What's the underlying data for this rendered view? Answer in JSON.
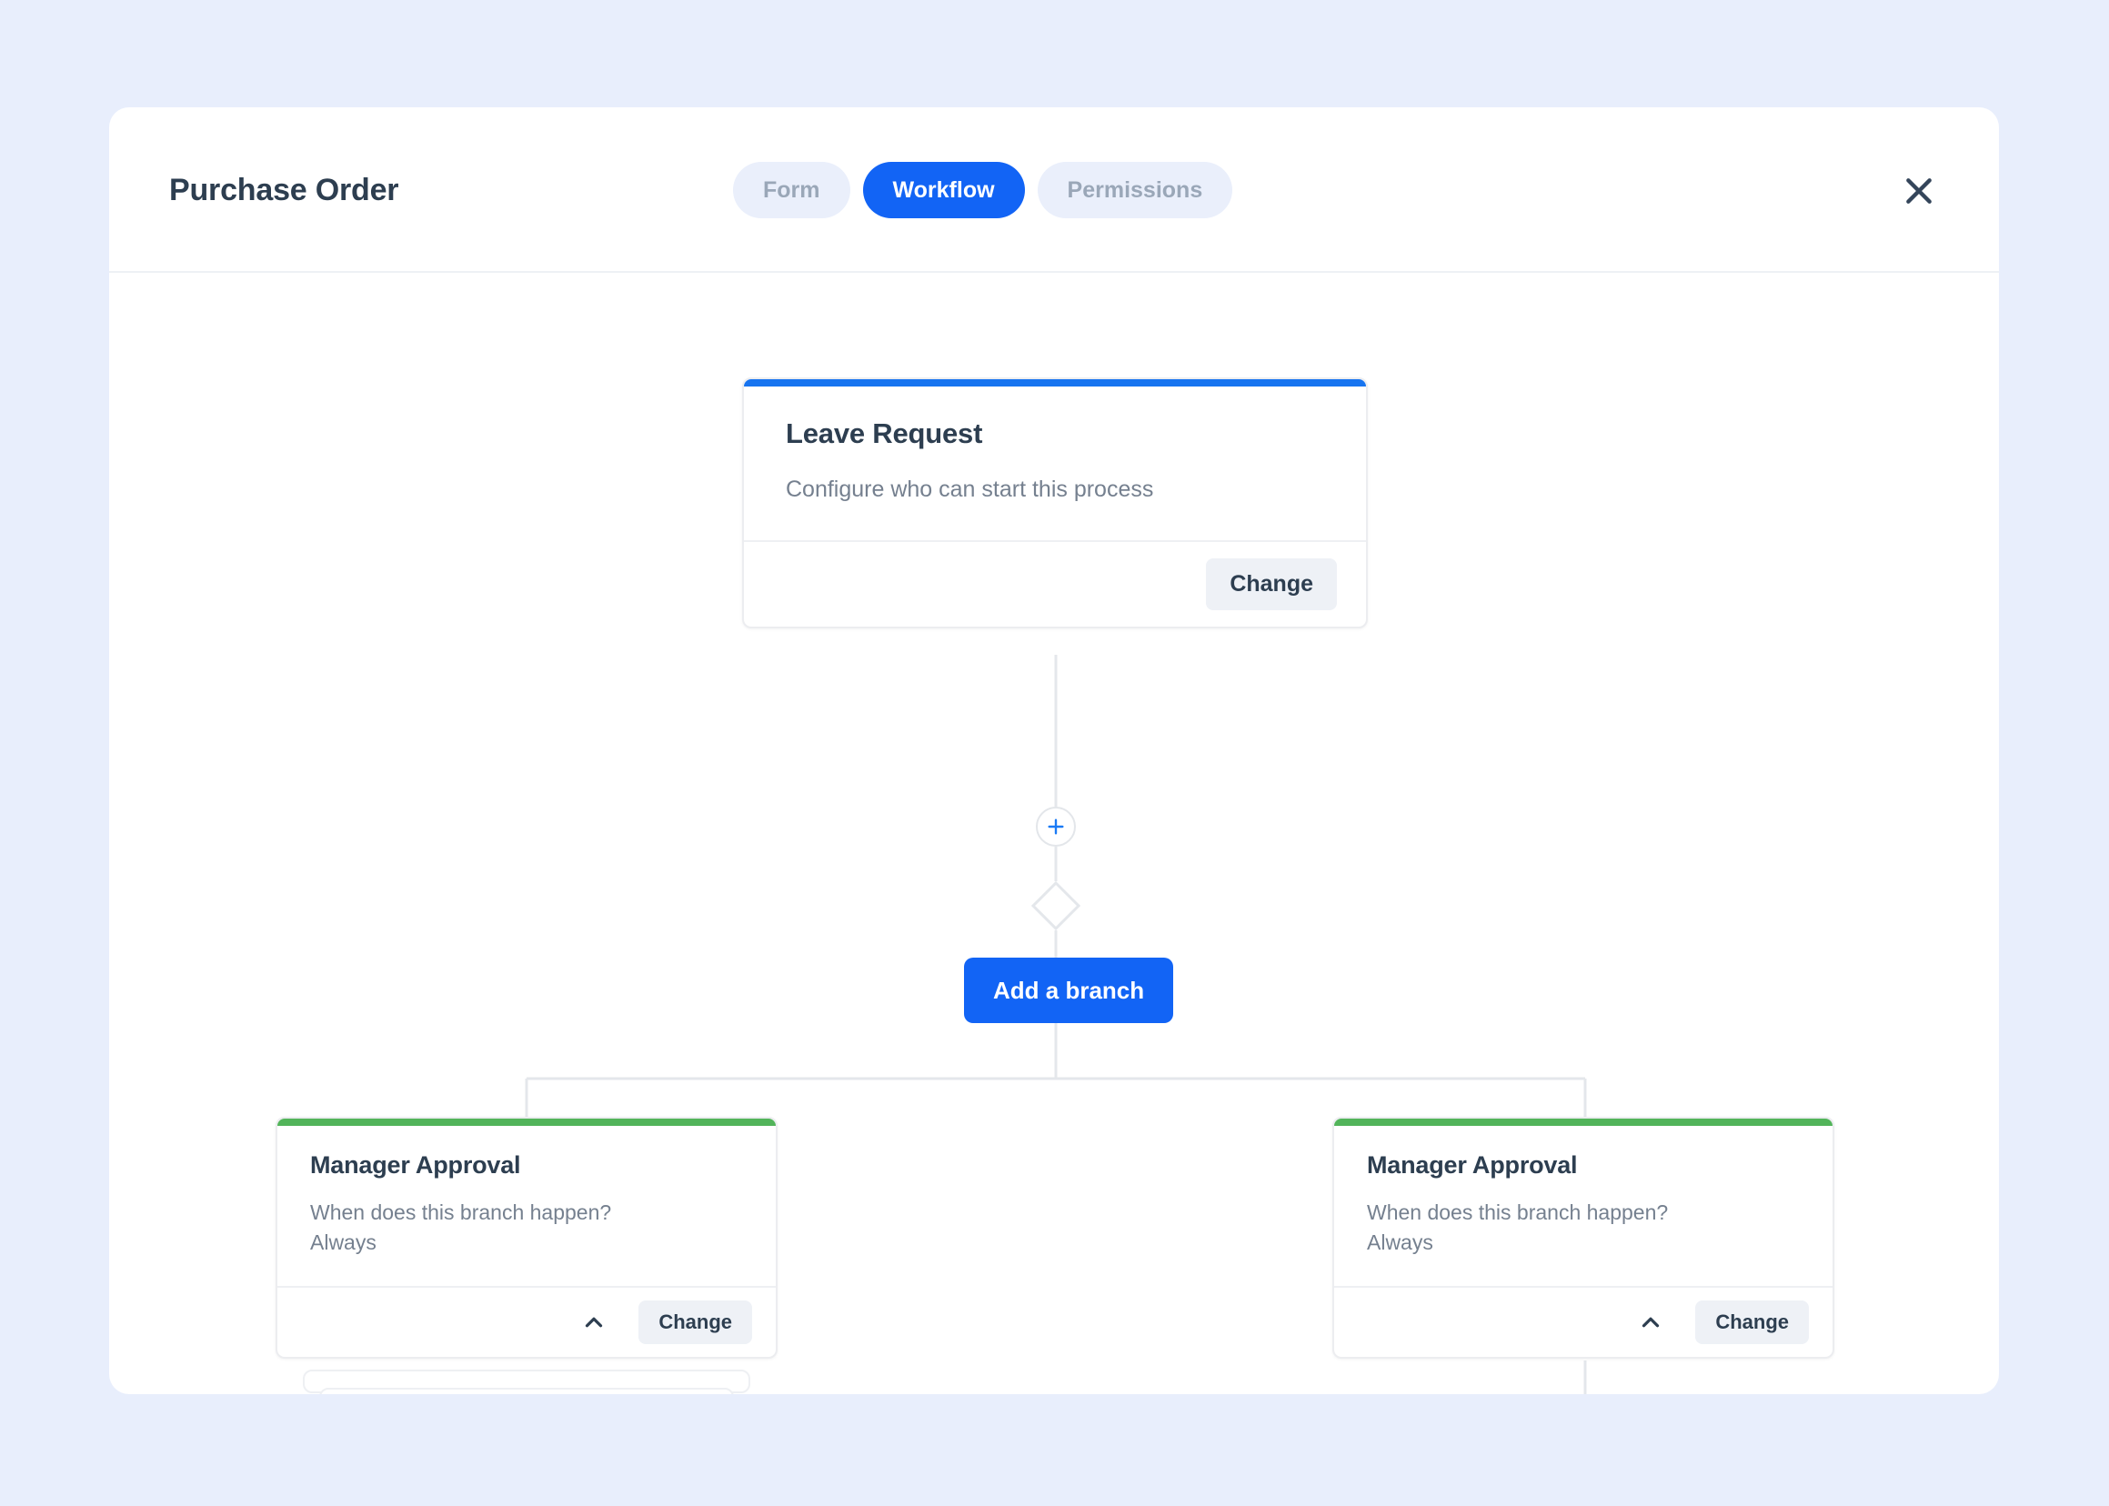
{
  "header": {
    "title": "Purchase Order",
    "tabs": [
      {
        "label": "Form",
        "active": false
      },
      {
        "label": "Workflow",
        "active": true
      },
      {
        "label": "Permissions",
        "active": false
      }
    ],
    "close_icon": "close-icon"
  },
  "workflow": {
    "start_node": {
      "title": "Leave Request",
      "description": "Configure who can start this process",
      "change_label": "Change",
      "accent_color": "#1774f0"
    },
    "add_step": {
      "icon": "plus-icon",
      "color": "#1a7af5"
    },
    "branch_gateway": {
      "icon": "diamond-icon",
      "add_branch_label": "Add a branch"
    },
    "branches": [
      {
        "title": "Manager Approval",
        "question": "When does this branch happen?",
        "condition": "Always",
        "collapse_icon": "chevron-up-icon",
        "change_label": "Change",
        "accent_color": "#52b45a",
        "has_stacked_steps": true
      },
      {
        "title": "Manager Approval",
        "question": "When does this branch happen?",
        "condition": "Always",
        "collapse_icon": "chevron-up-icon",
        "change_label": "Change",
        "accent_color": "#52b45a",
        "has_stacked_steps": false
      }
    ]
  },
  "colors": {
    "page_background": "#e8eefc",
    "surface": "#ffffff",
    "primary": "#1264f5",
    "success": "#52b45a",
    "text_primary": "#2d3e50",
    "text_muted": "#75808f",
    "connector": "#e4e7eb"
  }
}
